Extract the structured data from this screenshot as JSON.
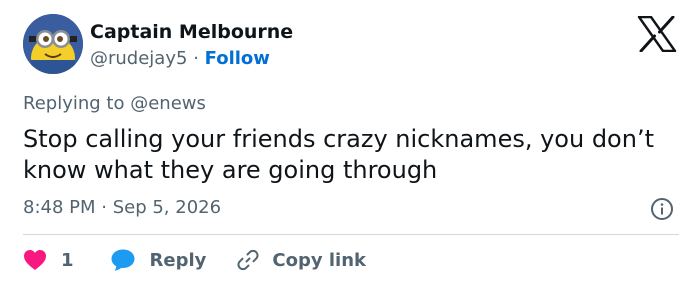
{
  "author": {
    "name": "Captain Melbourne",
    "handle": "@rudejay5",
    "separator": "·",
    "follow_label": "Follow"
  },
  "reply_context": {
    "prefix": "Replying to",
    "mention": "@enews"
  },
  "tweet": {
    "text": "Stop calling your friends crazy nicknames, you don’t know what they are going through",
    "timestamp": "8:48 PM · Sep 5, 2026"
  },
  "actions": {
    "like_count": "1",
    "reply_label": "Reply",
    "copy_link_label": "Copy link"
  },
  "icons": {
    "brand": "x-logo-icon",
    "info": "info-icon",
    "like": "heart-icon",
    "reply": "speech-bubble-icon",
    "copy": "link-icon"
  },
  "colors": {
    "primary_text": "#0f1419",
    "secondary_text": "#536471",
    "follow_blue": "#006fd6",
    "heart_pink": "#f91880",
    "reply_blue": "#1d9bf0",
    "divider": "#cfd9de"
  }
}
